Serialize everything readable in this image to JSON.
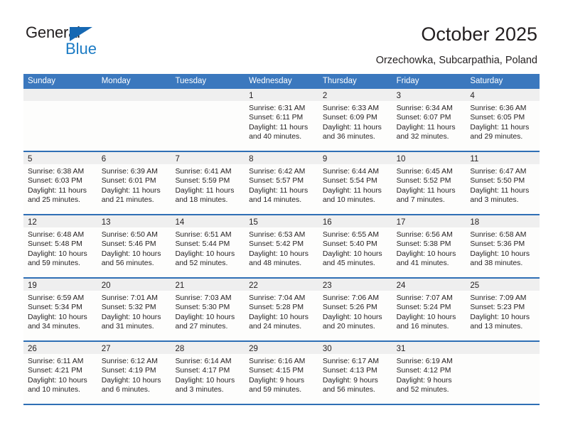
{
  "brand": {
    "name_top": "General",
    "name_bottom": "Blue"
  },
  "header": {
    "title": "October 2025",
    "location": "Orzechowka, Subcarpathia, Poland"
  },
  "colors": {
    "header_blue": "#3b78be",
    "row_divider_blue": "#2f6fb5",
    "daynum_strip": "#efefef",
    "brand_blue": "#1b7bc4",
    "text": "#231f20"
  },
  "calendar": {
    "weekdays": [
      "Sunday",
      "Monday",
      "Tuesday",
      "Wednesday",
      "Thursday",
      "Friday",
      "Saturday"
    ],
    "weeks": [
      [
        {
          "day": "",
          "lines": []
        },
        {
          "day": "",
          "lines": []
        },
        {
          "day": "",
          "lines": []
        },
        {
          "day": "1",
          "lines": [
            "Sunrise: 6:31 AM",
            "Sunset: 6:11 PM",
            "Daylight: 11 hours",
            "and 40 minutes."
          ]
        },
        {
          "day": "2",
          "lines": [
            "Sunrise: 6:33 AM",
            "Sunset: 6:09 PM",
            "Daylight: 11 hours",
            "and 36 minutes."
          ]
        },
        {
          "day": "3",
          "lines": [
            "Sunrise: 6:34 AM",
            "Sunset: 6:07 PM",
            "Daylight: 11 hours",
            "and 32 minutes."
          ]
        },
        {
          "day": "4",
          "lines": [
            "Sunrise: 6:36 AM",
            "Sunset: 6:05 PM",
            "Daylight: 11 hours",
            "and 29 minutes."
          ]
        }
      ],
      [
        {
          "day": "5",
          "lines": [
            "Sunrise: 6:38 AM",
            "Sunset: 6:03 PM",
            "Daylight: 11 hours",
            "and 25 minutes."
          ]
        },
        {
          "day": "6",
          "lines": [
            "Sunrise: 6:39 AM",
            "Sunset: 6:01 PM",
            "Daylight: 11 hours",
            "and 21 minutes."
          ]
        },
        {
          "day": "7",
          "lines": [
            "Sunrise: 6:41 AM",
            "Sunset: 5:59 PM",
            "Daylight: 11 hours",
            "and 18 minutes."
          ]
        },
        {
          "day": "8",
          "lines": [
            "Sunrise: 6:42 AM",
            "Sunset: 5:57 PM",
            "Daylight: 11 hours",
            "and 14 minutes."
          ]
        },
        {
          "day": "9",
          "lines": [
            "Sunrise: 6:44 AM",
            "Sunset: 5:54 PM",
            "Daylight: 11 hours",
            "and 10 minutes."
          ]
        },
        {
          "day": "10",
          "lines": [
            "Sunrise: 6:45 AM",
            "Sunset: 5:52 PM",
            "Daylight: 11 hours",
            "and 7 minutes."
          ]
        },
        {
          "day": "11",
          "lines": [
            "Sunrise: 6:47 AM",
            "Sunset: 5:50 PM",
            "Daylight: 11 hours",
            "and 3 minutes."
          ]
        }
      ],
      [
        {
          "day": "12",
          "lines": [
            "Sunrise: 6:48 AM",
            "Sunset: 5:48 PM",
            "Daylight: 10 hours",
            "and 59 minutes."
          ]
        },
        {
          "day": "13",
          "lines": [
            "Sunrise: 6:50 AM",
            "Sunset: 5:46 PM",
            "Daylight: 10 hours",
            "and 56 minutes."
          ]
        },
        {
          "day": "14",
          "lines": [
            "Sunrise: 6:51 AM",
            "Sunset: 5:44 PM",
            "Daylight: 10 hours",
            "and 52 minutes."
          ]
        },
        {
          "day": "15",
          "lines": [
            "Sunrise: 6:53 AM",
            "Sunset: 5:42 PM",
            "Daylight: 10 hours",
            "and 48 minutes."
          ]
        },
        {
          "day": "16",
          "lines": [
            "Sunrise: 6:55 AM",
            "Sunset: 5:40 PM",
            "Daylight: 10 hours",
            "and 45 minutes."
          ]
        },
        {
          "day": "17",
          "lines": [
            "Sunrise: 6:56 AM",
            "Sunset: 5:38 PM",
            "Daylight: 10 hours",
            "and 41 minutes."
          ]
        },
        {
          "day": "18",
          "lines": [
            "Sunrise: 6:58 AM",
            "Sunset: 5:36 PM",
            "Daylight: 10 hours",
            "and 38 minutes."
          ]
        }
      ],
      [
        {
          "day": "19",
          "lines": [
            "Sunrise: 6:59 AM",
            "Sunset: 5:34 PM",
            "Daylight: 10 hours",
            "and 34 minutes."
          ]
        },
        {
          "day": "20",
          "lines": [
            "Sunrise: 7:01 AM",
            "Sunset: 5:32 PM",
            "Daylight: 10 hours",
            "and 31 minutes."
          ]
        },
        {
          "day": "21",
          "lines": [
            "Sunrise: 7:03 AM",
            "Sunset: 5:30 PM",
            "Daylight: 10 hours",
            "and 27 minutes."
          ]
        },
        {
          "day": "22",
          "lines": [
            "Sunrise: 7:04 AM",
            "Sunset: 5:28 PM",
            "Daylight: 10 hours",
            "and 24 minutes."
          ]
        },
        {
          "day": "23",
          "lines": [
            "Sunrise: 7:06 AM",
            "Sunset: 5:26 PM",
            "Daylight: 10 hours",
            "and 20 minutes."
          ]
        },
        {
          "day": "24",
          "lines": [
            "Sunrise: 7:07 AM",
            "Sunset: 5:24 PM",
            "Daylight: 10 hours",
            "and 16 minutes."
          ]
        },
        {
          "day": "25",
          "lines": [
            "Sunrise: 7:09 AM",
            "Sunset: 5:23 PM",
            "Daylight: 10 hours",
            "and 13 minutes."
          ]
        }
      ],
      [
        {
          "day": "26",
          "lines": [
            "Sunrise: 6:11 AM",
            "Sunset: 4:21 PM",
            "Daylight: 10 hours",
            "and 10 minutes."
          ]
        },
        {
          "day": "27",
          "lines": [
            "Sunrise: 6:12 AM",
            "Sunset: 4:19 PM",
            "Daylight: 10 hours",
            "and 6 minutes."
          ]
        },
        {
          "day": "28",
          "lines": [
            "Sunrise: 6:14 AM",
            "Sunset: 4:17 PM",
            "Daylight: 10 hours",
            "and 3 minutes."
          ]
        },
        {
          "day": "29",
          "lines": [
            "Sunrise: 6:16 AM",
            "Sunset: 4:15 PM",
            "Daylight: 9 hours",
            "and 59 minutes."
          ]
        },
        {
          "day": "30",
          "lines": [
            "Sunrise: 6:17 AM",
            "Sunset: 4:13 PM",
            "Daylight: 9 hours",
            "and 56 minutes."
          ]
        },
        {
          "day": "31",
          "lines": [
            "Sunrise: 6:19 AM",
            "Sunset: 4:12 PM",
            "Daylight: 9 hours",
            "and 52 minutes."
          ]
        },
        {
          "day": "",
          "lines": []
        }
      ]
    ]
  }
}
